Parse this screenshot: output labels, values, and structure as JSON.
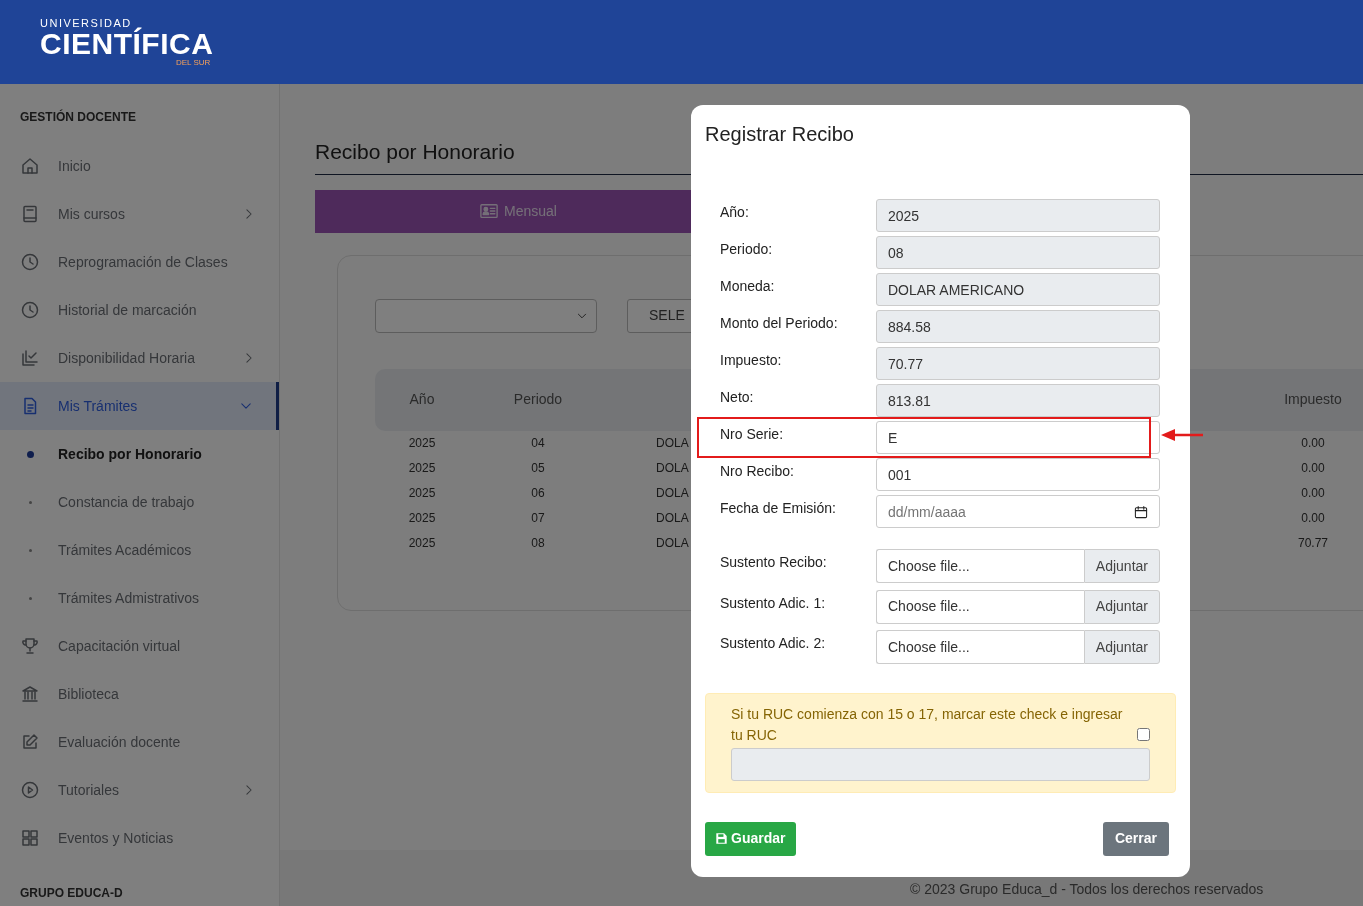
{
  "header": {
    "logo_top": "UNIVERSIDAD",
    "logo_main": "CIENTÍFICA",
    "logo_bottom": "DEL SUR"
  },
  "sidebar": {
    "heading": "GESTIÓN DOCENTE",
    "items": [
      {
        "label": "Inicio",
        "selected": false
      },
      {
        "label": "Mis cursos",
        "selected": false,
        "expanded": false
      },
      {
        "label": "Reprogramación de Clases",
        "selected": false
      },
      {
        "label": "Historial de marcación",
        "selected": false
      },
      {
        "label": "Disponibilidad Horaria",
        "selected": false,
        "expanded": false
      },
      {
        "label": "Mis Trámites",
        "selected": true,
        "expanded": true,
        "children": [
          {
            "label": "Recibo por Honorario",
            "selected": true
          },
          {
            "label": "Constancia de trabajo",
            "selected": false
          },
          {
            "label": "Trámites Académicos",
            "selected": false
          },
          {
            "label": "Trámites Admistrativos",
            "selected": false
          }
        ]
      },
      {
        "label": "Capacitación virtual",
        "selected": false
      },
      {
        "label": "Biblioteca",
        "selected": false
      },
      {
        "label": "Evaluación docente",
        "selected": false
      },
      {
        "label": "Tutoriales",
        "selected": false,
        "expanded": false
      },
      {
        "label": "Eventos y Noticias",
        "selected": false
      }
    ],
    "footer_heading": "GRUPO EDUCA-D"
  },
  "page": {
    "title": "Recibo por Honorario",
    "tabs": [
      {
        "label": "Mensual",
        "selected": true
      }
    ],
    "select_button": "SELE",
    "table": {
      "headers": {
        "year": "Año",
        "period": "Periodo",
        "tax": "Impuesto"
      },
      "rows": [
        {
          "year": "2025",
          "period": "04",
          "column_3": "DOLA",
          "tax": "0.00"
        },
        {
          "year": "2025",
          "period": "05",
          "column_3": "DOLA",
          "tax": "0.00"
        },
        {
          "year": "2025",
          "period": "06",
          "column_3": "DOLA",
          "tax": "0.00"
        },
        {
          "year": "2025",
          "period": "07",
          "column_3": "DOLA",
          "tax": "0.00"
        },
        {
          "year": "2025",
          "period": "08",
          "column_3": "DOLA",
          "tax": "70.77"
        }
      ]
    },
    "footer": "© 2023 Grupo Educa_d - Todos los derechos reservados"
  },
  "modal": {
    "title": "Registrar Recibo",
    "fields": [
      {
        "kind": "readonly",
        "label": "Año:",
        "value": "2025",
        "highlighted": false
      },
      {
        "kind": "readonly",
        "label": "Periodo:",
        "value": "08",
        "highlighted": false
      },
      {
        "kind": "readonly",
        "label": "Moneda:",
        "value": "DOLAR AMERICANO",
        "highlighted": false
      },
      {
        "kind": "readonly",
        "label": "Monto del Periodo:",
        "value": "884.58",
        "highlighted": false
      },
      {
        "kind": "readonly",
        "label": "Impuesto:",
        "value": "70.77",
        "highlighted": false
      },
      {
        "kind": "readonly",
        "label": "Neto:",
        "value": "813.81",
        "highlighted": false
      },
      {
        "kind": "text",
        "label": "Nro Serie:",
        "value": "E",
        "highlighted": true
      },
      {
        "kind": "text",
        "label": "Nro Recibo:",
        "value": "001",
        "highlighted": false
      },
      {
        "kind": "date",
        "label": "Fecha de Emisión:",
        "placeholder": "dd/mm/aaaa",
        "highlighted": false
      }
    ],
    "attachments": [
      {
        "label": "Sustento Recibo:",
        "placeholder": "Choose file...",
        "button": "Adjuntar"
      },
      {
        "label": "Sustento Adic. 1:",
        "placeholder": "Choose file...",
        "button": "Adjuntar"
      },
      {
        "label": "Sustento Adic. 2:",
        "placeholder": "Choose file...",
        "button": "Adjuntar"
      }
    ],
    "ruc_notice": {
      "text": "Si tu RUC comienza con 15 o 17, marcar este check e ingresar tu RUC",
      "checked": false,
      "field_disabled": true
    },
    "buttons": {
      "save": "Guardar",
      "close": "Cerrar"
    }
  }
}
